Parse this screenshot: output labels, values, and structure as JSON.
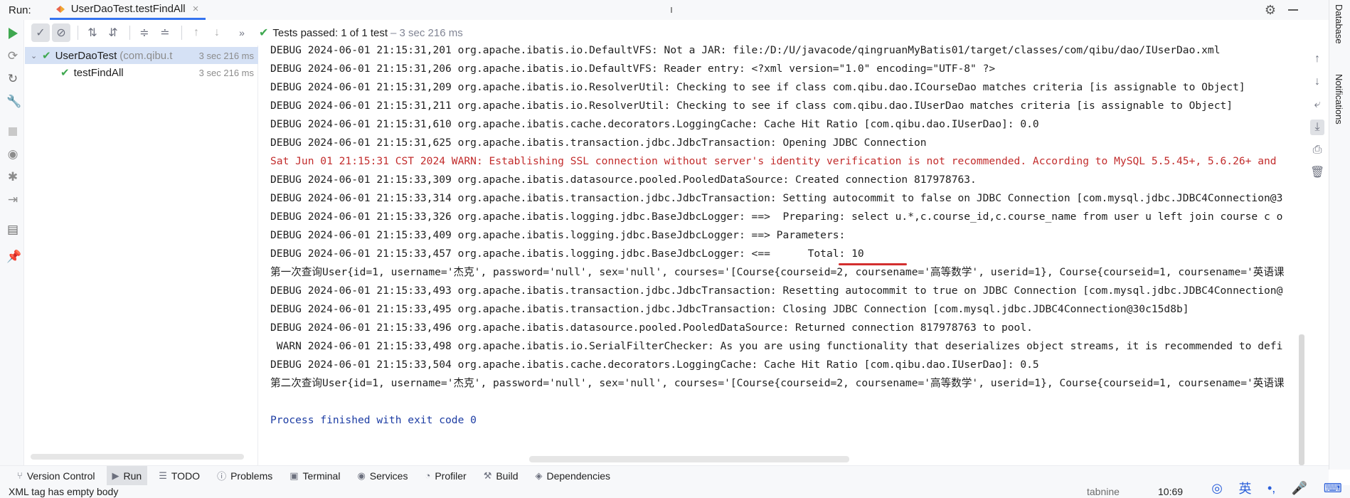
{
  "titlebar": {
    "run_label": "Run:",
    "tab_title": "UserDaoTest.testFindAll",
    "tab_close": "×",
    "settings_icon": "⚙"
  },
  "right_stripe": {
    "database": "Database",
    "notifications": "Notifications"
  },
  "test_toolbar": {
    "status_main": "Tests passed: 1",
    "status_count": "of 1 test",
    "status_detail": "– 3 sec 216 ms",
    "check_icon": "✔",
    "more": "»"
  },
  "tree": {
    "root_name": "UserDaoTest",
    "root_pkg": "(com.qibu.t",
    "root_time": "3 sec 216 ms",
    "child_name": "testFindAll",
    "child_time": "3 sec 216 ms"
  },
  "console": {
    "lines": [
      "DEBUG 2024-06-01 21:15:31,201 org.apache.ibatis.io.DefaultVFS: Not a JAR: file:/D:/U/javacode/qingruanMyBatis01/target/classes/com/qibu/dao/IUserDao.xml",
      "DEBUG 2024-06-01 21:15:31,206 org.apache.ibatis.io.DefaultVFS: Reader entry: <?xml version=\"1.0\" encoding=\"UTF-8\" ?>",
      "DEBUG 2024-06-01 21:15:31,209 org.apache.ibatis.io.ResolverUtil: Checking to see if class com.qibu.dao.ICourseDao matches criteria [is assignable to Object]",
      "DEBUG 2024-06-01 21:15:31,211 org.apache.ibatis.io.ResolverUtil: Checking to see if class com.qibu.dao.IUserDao matches criteria [is assignable to Object]",
      "DEBUG 2024-06-01 21:15:31,610 org.apache.ibatis.cache.decorators.LoggingCache: Cache Hit Ratio [com.qibu.dao.IUserDao]: 0.0",
      "DEBUG 2024-06-01 21:15:31,625 org.apache.ibatis.transaction.jdbc.JdbcTransaction: Opening JDBC Connection",
      "Sat Jun 01 21:15:31 CST 2024 WARN: Establishing SSL connection without server's identity verification is not recommended. According to MySQL 5.5.45+, 5.6.26+ and",
      "DEBUG 2024-06-01 21:15:33,309 org.apache.ibatis.datasource.pooled.PooledDataSource: Created connection 817978763.",
      "DEBUG 2024-06-01 21:15:33,314 org.apache.ibatis.transaction.jdbc.JdbcTransaction: Setting autocommit to false on JDBC Connection [com.mysql.jdbc.JDBC4Connection@3",
      "DEBUG 2024-06-01 21:15:33,326 org.apache.ibatis.logging.jdbc.BaseJdbcLogger: ==>  Preparing: select u.*,c.course_id,c.course_name from user u left join course c o",
      "DEBUG 2024-06-01 21:15:33,409 org.apache.ibatis.logging.jdbc.BaseJdbcLogger: ==> Parameters: ",
      "DEBUG 2024-06-01 21:15:33,457 org.apache.ibatis.logging.jdbc.BaseJdbcLogger: <==      Total: 10",
      "第一次查询User{id=1, username='杰克', password='null', sex='null', courses='[Course{courseid=2, coursename='高等数学', userid=1}, Course{courseid=1, coursename='英语课",
      "DEBUG 2024-06-01 21:15:33,493 org.apache.ibatis.transaction.jdbc.JdbcTransaction: Resetting autocommit to true on JDBC Connection [com.mysql.jdbc.JDBC4Connection@",
      "DEBUG 2024-06-01 21:15:33,495 org.apache.ibatis.transaction.jdbc.JdbcTransaction: Closing JDBC Connection [com.mysql.jdbc.JDBC4Connection@30c15d8b]",
      "DEBUG 2024-06-01 21:15:33,496 org.apache.ibatis.datasource.pooled.PooledDataSource: Returned connection 817978763 to pool.",
      " WARN 2024-06-01 21:15:33,498 org.apache.ibatis.io.SerialFilterChecker: As you are using functionality that deserializes object streams, it is recommended to defi",
      "DEBUG 2024-06-01 21:15:33,504 org.apache.ibatis.cache.decorators.LoggingCache: Cache Hit Ratio [com.qibu.dao.IUserDao]: 0.5",
      "第二次查询User{id=1, username='杰克', password='null', sex='null', courses='[Course{courseid=2, coursename='高等数学', userid=1}, Course{courseid=1, coursename='英语课",
      "",
      "Process finished with exit code 0"
    ]
  },
  "bottom_bar": {
    "items": [
      "Version Control",
      "Run",
      "TODO",
      "Problems",
      "Terminal",
      "Services",
      "Profiler",
      "Build",
      "Dependencies"
    ]
  },
  "status_bar": {
    "message": "XML tag has empty body",
    "tabnine": "tabnine",
    "time": "10:69",
    "ime_lang": "英"
  },
  "colors": {
    "accent": "#3574f0",
    "pass_green": "#3fa850",
    "warn_red": "#c22c2c",
    "process_blue": "#1c3ca3",
    "underline_red": "#d32f2f"
  }
}
